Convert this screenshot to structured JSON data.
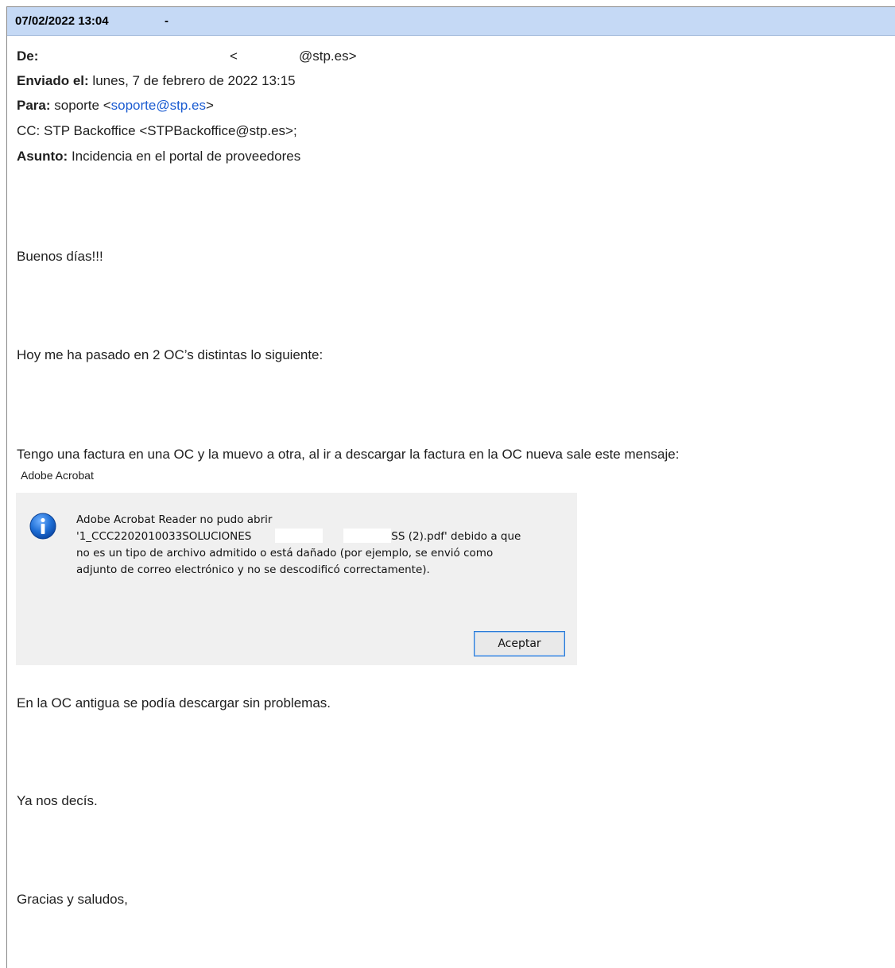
{
  "titlebar": {
    "date": "07/02/2022 13:04",
    "dash": "-"
  },
  "header": {
    "from_label": "De:",
    "from_lt": "<",
    "from_email": "@stp.es>",
    "sent_label": "Enviado el:",
    "sent_value": "lunes, 7 de febrero de 2022 13:15",
    "to_label": "Para:",
    "to_name": "soporte <",
    "to_email": "soporte@stp.es",
    "to_close": ">",
    "cc_text": "CC: STP Backoffice <STPBackoffice@stp.es>;",
    "subject_label": "Asunto:",
    "subject_value": "Incidencia en el portal de proveedores"
  },
  "body": {
    "greeting": "Buenos días!!!",
    "line1": "Hoy me ha pasado en 2 OC’s distintas lo siguiente:",
    "line2": "Tengo una factura en una OC y la muevo a otra, al ir a descargar la factura en la OC nueva sale este mensaje:",
    "line3": "En la OC antigua se podía descargar sin problemas.",
    "line4": "Ya nos decís.",
    "closing": "Gracias y saludos,"
  },
  "dialog": {
    "app_title": "Adobe Acrobat",
    "icon": "info-icon",
    "message": "Adobe Acrobat Reader no pudo abrir\n'1_CCC2202010033SOLUCIONES            RO                ESCASS (2).pdf' debido a que\nno es un tipo de archivo admitido o está dañado (por ejemplo, se envió como\nadjunto de correo electrónico y no se descodificó correctamente).",
    "ok_label": "Aceptar"
  },
  "colors": {
    "titlebar_bg": "#c5d9f5",
    "link": "#1a5bd1",
    "dialog_bg": "#f0f0f0"
  }
}
